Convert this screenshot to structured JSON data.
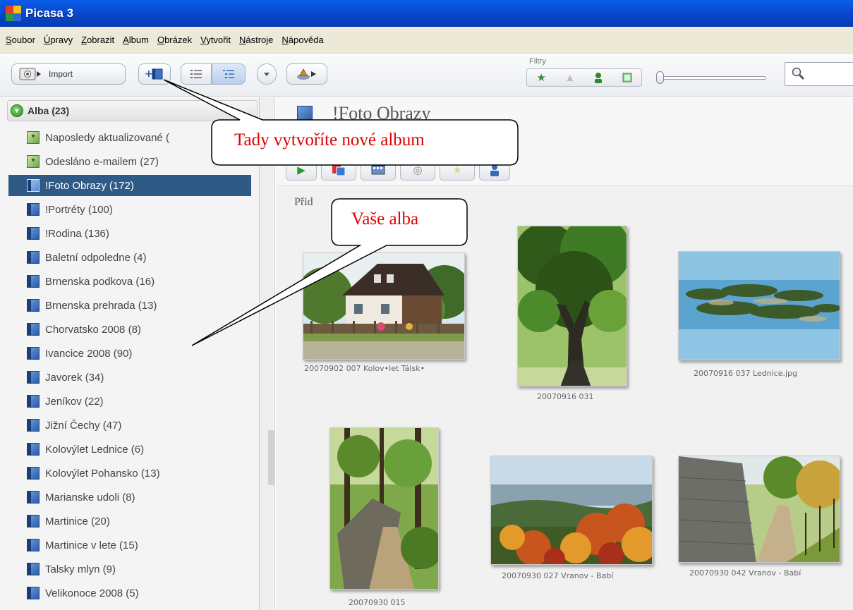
{
  "window": {
    "title": "Picasa 3"
  },
  "menu": [
    "Soubor",
    "Úpravy",
    "Zobrazit",
    "Album",
    "Obrázek",
    "Vytvořit",
    "Nástroje",
    "Nápověda"
  ],
  "toolbar": {
    "import_label": "Import",
    "filters_label": "Filtry",
    "search_placeholder": ""
  },
  "sidebar": {
    "group": {
      "label": "Alba (23)",
      "expanded": true
    },
    "items": [
      {
        "label": "Naposledy aktualizované (",
        "icon": "green",
        "selected": false
      },
      {
        "label": "Odesláno e-mailem (27)",
        "icon": "green",
        "selected": false
      },
      {
        "label": "!Foto Obrazy (172)",
        "icon": "blue",
        "selected": true
      },
      {
        "label": "!Portréty (100)",
        "icon": "blue",
        "selected": false
      },
      {
        "label": "!Rodina (136)",
        "icon": "blue",
        "selected": false
      },
      {
        "label": "Baletní odpoledne (4)",
        "icon": "blue",
        "selected": false
      },
      {
        "label": "Brnenska podkova (16)",
        "icon": "blue",
        "selected": false
      },
      {
        "label": "Brnenska prehrada (13)",
        "icon": "blue",
        "selected": false
      },
      {
        "label": "Chorvatsko 2008 (8)",
        "icon": "blue",
        "selected": false
      },
      {
        "label": "Ivancice 2008 (90)",
        "icon": "blue",
        "selected": false
      },
      {
        "label": "Javorek (34)",
        "icon": "blue",
        "selected": false
      },
      {
        "label": "Jeníkov (22)",
        "icon": "blue",
        "selected": false
      },
      {
        "label": "Jižní Čechy (47)",
        "icon": "blue",
        "selected": false
      },
      {
        "label": "Kolovýlet Lednice (6)",
        "icon": "blue",
        "selected": false
      },
      {
        "label": "Kolovýlet Pohansko (13)",
        "icon": "blue",
        "selected": false
      },
      {
        "label": "Marianske udoli (8)",
        "icon": "blue",
        "selected": false
      },
      {
        "label": "Martinice (20)",
        "icon": "blue",
        "selected": false
      },
      {
        "label": "Martinice v lete (15)",
        "icon": "blue",
        "selected": false
      },
      {
        "label": "Talsky mlyn (9)",
        "icon": "blue",
        "selected": false
      },
      {
        "label": "Velikonoce 2008 (5)",
        "icon": "blue",
        "selected": false
      }
    ]
  },
  "main": {
    "album_title": "!Foto Obrazy",
    "added_label": "Přid",
    "photos": [
      {
        "caption": "20070902 007 Kolov•let Tálsk•",
        "subject": "cottage"
      },
      {
        "caption": "20070916 031",
        "subject": "oak-tree"
      },
      {
        "caption": "20070916 037 Lednice.jpg",
        "subject": "pond"
      },
      {
        "caption": "20070930 015",
        "subject": "forest-path"
      },
      {
        "caption": "20070930 027 Vranov - Babí",
        "subject": "autumn-valley"
      },
      {
        "caption": "20070930 042 Vranov - Babí",
        "subject": "wall-path"
      }
    ]
  },
  "callouts": {
    "new_album": "Tady vytvoříte nové album",
    "your_albums": "Vaše alba"
  },
  "colors": {
    "titlebar": "#0846c8",
    "selection": "#2f5a86",
    "callout_text": "#e00000"
  }
}
